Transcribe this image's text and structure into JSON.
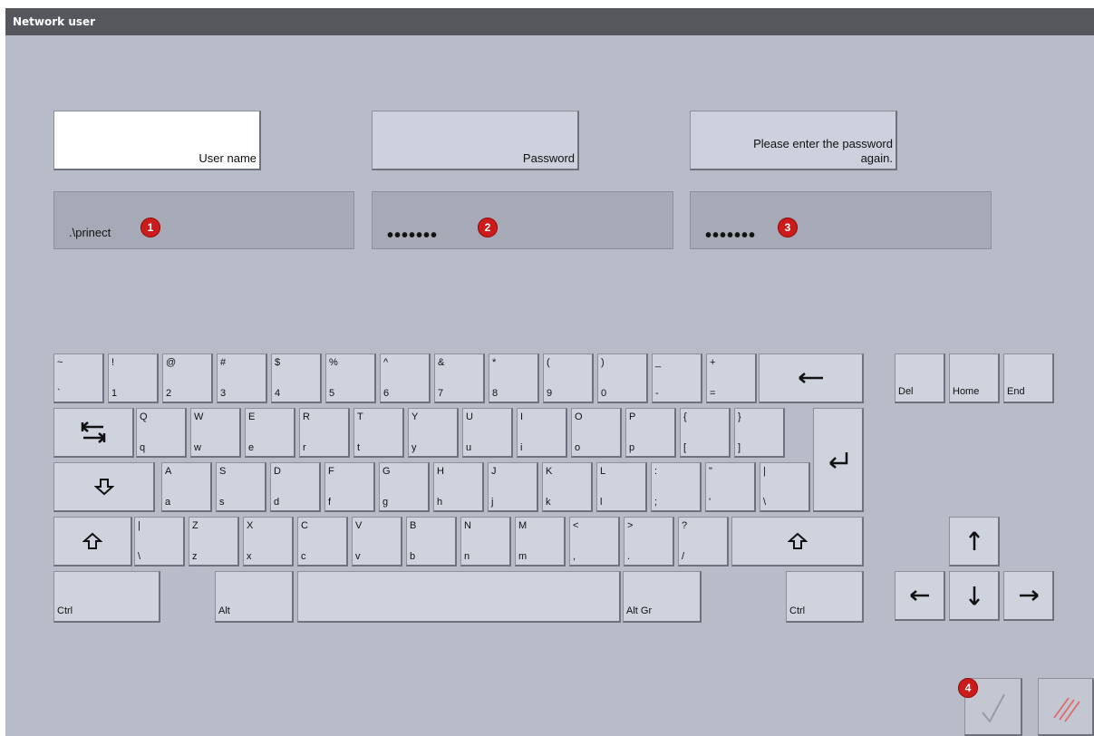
{
  "window": {
    "title": "Network user"
  },
  "labels": {
    "username": "User name",
    "password": "Password",
    "confirm_line1": "Please enter the password",
    "confirm_line2": "again."
  },
  "fields": {
    "username_value": ".\\prinect",
    "password_value": "•••••••",
    "confirm_value": "•••••••"
  },
  "badges": [
    "1",
    "2",
    "3",
    "4"
  ],
  "keyboard": {
    "rows": [
      [
        [
          "~",
          "`"
        ],
        [
          "!",
          "1"
        ],
        [
          "@",
          "2"
        ],
        [
          "#",
          "3"
        ],
        [
          "$",
          "4"
        ],
        [
          "%",
          "5"
        ],
        [
          "^",
          "6"
        ],
        [
          "&",
          "7"
        ],
        [
          "*",
          "8"
        ],
        [
          "(",
          "9"
        ],
        [
          ")",
          "0"
        ],
        [
          "_",
          "-"
        ],
        [
          "+",
          "="
        ]
      ],
      [
        [
          "Q",
          "q"
        ],
        [
          "W",
          "w"
        ],
        [
          "E",
          "e"
        ],
        [
          "R",
          "r"
        ],
        [
          "T",
          "t"
        ],
        [
          "Y",
          "y"
        ],
        [
          "U",
          "u"
        ],
        [
          "I",
          "i"
        ],
        [
          "O",
          "o"
        ],
        [
          "P",
          "p"
        ],
        [
          "{",
          "["
        ],
        [
          "}",
          "]"
        ]
      ],
      [
        [
          "A",
          "a"
        ],
        [
          "S",
          "s"
        ],
        [
          "D",
          "d"
        ],
        [
          "F",
          "f"
        ],
        [
          "G",
          "g"
        ],
        [
          "H",
          "h"
        ],
        [
          "J",
          "j"
        ],
        [
          "K",
          "k"
        ],
        [
          "L",
          "l"
        ],
        [
          ":",
          ";"
        ],
        [
          "\"",
          "'"
        ],
        [
          "|",
          "\\"
        ]
      ],
      [
        [
          "|",
          "\\"
        ],
        [
          "Z",
          "z"
        ],
        [
          "X",
          "x"
        ],
        [
          "C",
          "c"
        ],
        [
          "V",
          "v"
        ],
        [
          "B",
          "b"
        ],
        [
          "N",
          "n"
        ],
        [
          "M",
          "m"
        ],
        [
          "<",
          ","
        ],
        [
          ">",
          "."
        ],
        [
          "?",
          "/"
        ]
      ]
    ],
    "ctrl_left": "Ctrl",
    "alt": "Alt",
    "altgr": "Alt Gr",
    "ctrl_right": "Ctrl",
    "del": "Del",
    "home": "Home",
    "end": "End"
  },
  "icons": {
    "backspace": "arrow-left-icon",
    "tab": "tab-icon",
    "capslock": "caps-lock-icon",
    "enter": "enter-icon",
    "shift": "shift-icon",
    "arrows": [
      "arrow-up-icon",
      "arrow-left-icon",
      "arrow-down-icon",
      "arrow-right-icon"
    ],
    "confirm": "checkmark-icon",
    "cancel": "cancel-hatch-icon"
  },
  "colors": {
    "title_bar": "#55575c",
    "background": "#b8bcc8",
    "badge": "#cc1b1b",
    "cancel_stroke": "#e06a6a"
  }
}
